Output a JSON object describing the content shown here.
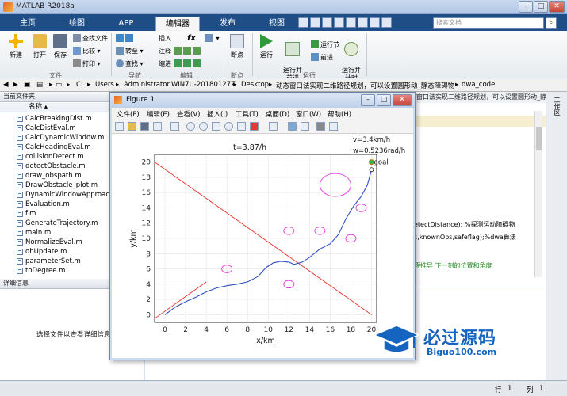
{
  "window": {
    "title": "MATLAB R2018a"
  },
  "tabs": [
    "主页",
    "绘图",
    "APP",
    "编辑器",
    "发布",
    "视图"
  ],
  "search_placeholder": "搜索文档",
  "ribbon": {
    "new": "新建",
    "open": "打开",
    "save": "保存",
    "find_files": "查找文件",
    "compare": "比较",
    "print": "打印",
    "goto": "转至",
    "find": "查找",
    "insert": "插入",
    "comment": "注释",
    "indent": "缩进",
    "fx": "fx",
    "breakpoints": "断点",
    "run": "运行",
    "run_advance": "运行并\n前进",
    "run_section": "运行节",
    "advance": "前进",
    "run_time": "运行并\n计时",
    "groups": {
      "file": "文件",
      "nav": "导航",
      "edit": "编辑",
      "bp": "断点",
      "run": "运行"
    }
  },
  "path": {
    "segments": [
      "C:",
      "Users",
      "Administrator.WIN7U-20180127Z",
      "Desktop",
      "动态窗口法实现二维路径规划，可以设置圆形动_静态障碍物",
      "dwa_code"
    ]
  },
  "left_panel": {
    "header": "当前文件夹",
    "col_name": "名称",
    "files": [
      "CalcBreakingDist.m",
      "CalcDistEval.m",
      "CalcDynamicWindow.m",
      "CalcHeadingEval.m",
      "collisionDetect.m",
      "detectObstacle.m",
      "draw_obspath.m",
      "DrawObstacle_plot.m",
      "DynamicWindowApproach",
      "Evaluation.m",
      "f.m",
      "GenerateTrajectory.m",
      "main.m",
      "NormalizeEval.m",
      "obUpdate.m",
      "parameterSet.m",
      "toDegree.m"
    ],
    "details_header": "详细信息",
    "details_msg": "选择文件以查看详细信息"
  },
  "editor": {
    "tab_text": "窗口法实现二维路径规划，可以设置圆形动_静态障碍物...",
    "code_lines": [
      "etectDistance);  %探测运动障碍物",
      "s,knownObs,safeflag);%dwa算法",
      "逐推导 下一刻的位置和角度"
    ]
  },
  "side_label": "工作区",
  "status": {
    "row_label": "行",
    "row": "1",
    "col_label": "列",
    "col": "1"
  },
  "figure": {
    "title": "Figure 1",
    "menus": [
      "文件(F)",
      "编辑(E)",
      "查看(V)",
      "插入(I)",
      "工具(T)",
      "桌面(D)",
      "窗口(W)",
      "帮助(H)"
    ]
  },
  "chart_data": {
    "type": "line",
    "title": "t=3.87/h",
    "annotation_v": "v=3.4km/h",
    "annotation_w": "w=0.5236rad/h",
    "goal_label": "goal",
    "xlabel": "x/km",
    "ylabel": "y/km",
    "xlim": [
      -1,
      20.5
    ],
    "ylim": [
      -1,
      21
    ],
    "xticks": [
      0,
      2,
      4,
      6,
      8,
      10,
      12,
      14,
      16,
      18,
      20
    ],
    "yticks": [
      0,
      2,
      4,
      6,
      8,
      10,
      12,
      14,
      16,
      18,
      20
    ],
    "grid": true,
    "robot_path": [
      [
        0,
        0
      ],
      [
        1,
        1
      ],
      [
        2,
        1.7
      ],
      [
        3,
        2.3
      ],
      [
        4,
        3
      ],
      [
        5,
        3.5
      ],
      [
        6,
        3.8
      ],
      [
        7,
        4
      ],
      [
        8,
        4.3
      ],
      [
        9,
        5
      ],
      [
        9.8,
        6.2
      ],
      [
        10.5,
        6.8
      ],
      [
        11.2,
        7
      ],
      [
        12,
        6.9
      ],
      [
        12.5,
        6.6
      ],
      [
        13.3,
        6.9
      ],
      [
        14,
        7.5
      ],
      [
        15,
        8.6
      ],
      [
        16,
        9.3
      ],
      [
        16.8,
        10.5
      ],
      [
        17.5,
        12.5
      ],
      [
        18.3,
        14.3
      ],
      [
        19,
        15.5
      ],
      [
        19.6,
        17
      ],
      [
        20,
        19
      ]
    ],
    "static_obstacles": [
      {
        "x": 6,
        "y": 6,
        "r": 0.5
      },
      {
        "x": 12,
        "y": 4,
        "r": 0.5
      },
      {
        "x": 12,
        "y": 11,
        "r": 0.5
      },
      {
        "x": 15,
        "y": 11,
        "r": 0.5
      },
      {
        "x": 18,
        "y": 10,
        "r": 0.5
      },
      {
        "x": 19,
        "y": 14,
        "r": 0.5
      },
      {
        "x": 16.5,
        "y": 17,
        "r": 1.5
      }
    ],
    "moving_obstacle_line": [
      [
        -1,
        20
      ],
      [
        20,
        0
      ]
    ],
    "moving_obstacle_line2": [
      [
        -1,
        -0.5
      ],
      [
        4,
        4.3
      ]
    ],
    "goal": [
      20,
      20
    ],
    "robot": [
      20,
      19
    ]
  },
  "watermark": {
    "big": "必过源码",
    "small": "Biguo100.com"
  },
  "colors": {
    "tabbar": "#1f4e86",
    "path": "#3050c0",
    "obstacle": "#e03ad8",
    "line": "#e8312b"
  }
}
